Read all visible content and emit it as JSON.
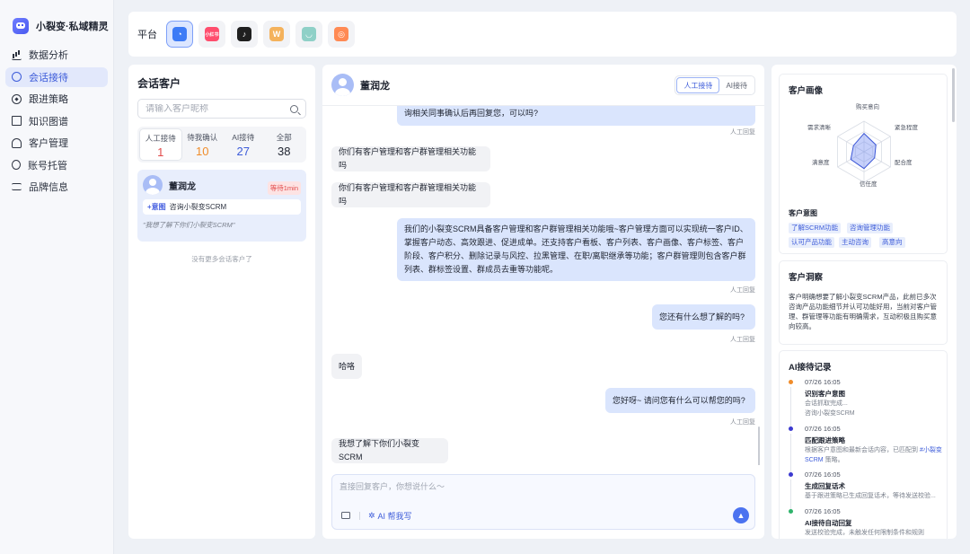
{
  "brand": {
    "name": "小裂变·私域精灵"
  },
  "nav": [
    {
      "label": "数据分析",
      "icon": "chart-icon"
    },
    {
      "label": "会话接待",
      "icon": "chat-icon",
      "active": true
    },
    {
      "label": "跟进策略",
      "icon": "compass-icon"
    },
    {
      "label": "知识图谱",
      "icon": "book-icon"
    },
    {
      "label": "客户管理",
      "icon": "user-icon"
    },
    {
      "label": "账号托管",
      "icon": "users-icon"
    },
    {
      "label": "品牌信息",
      "icon": "sliders-icon"
    }
  ],
  "platform": {
    "label": "平台",
    "items": [
      {
        "name": "wecom",
        "icon": "wecom-icon",
        "selected": true,
        "color": "#3d7bf6",
        "glyph": "◔"
      },
      {
        "name": "xiaohongshu",
        "icon": "xiaohongshu-icon",
        "color": "#ff4d6d",
        "glyph": "小红书"
      },
      {
        "name": "douyin",
        "icon": "douyin-icon",
        "color": "#1f1f1f",
        "glyph": "♪"
      },
      {
        "name": "weibo",
        "icon": "weibo-icon",
        "color": "#f4b25c",
        "glyph": "W"
      },
      {
        "name": "miniapp",
        "icon": "miniapp-icon",
        "color": "#8fd0c7",
        "glyph": "◡"
      },
      {
        "name": "kuaishou",
        "icon": "kuaishou-icon",
        "color": "#ff8a54",
        "glyph": "◎"
      }
    ]
  },
  "conversations": {
    "title": "会话客户",
    "search_placeholder": "请输入客户昵称",
    "tabs": [
      {
        "label": "人工接待",
        "count": "1",
        "color": "#e24a4a",
        "active": true
      },
      {
        "label": "待我确认",
        "count": "10",
        "color": "#f08c2a"
      },
      {
        "label": "AI接待",
        "count": "27",
        "color": "#3c5bd9"
      },
      {
        "label": "全部",
        "count": "38",
        "color": "#1f2430"
      }
    ],
    "card": {
      "name": "董润龙",
      "badge": "等待1min",
      "intent_tag": "+意图",
      "intent_text": "咨询小裂变SCRM",
      "quote": "\"我想了解下你们小裂变SCRM\""
    },
    "no_more": "没有更多会话客户了"
  },
  "chat": {
    "contact_name": "董润龙",
    "modes": [
      {
        "label": "人工接待",
        "active": true
      },
      {
        "label": "AI接待",
        "active": false
      }
    ],
    "messages": [
      {
        "dir": "out",
        "text": "询相关同事确认后再回复您，可以吗?",
        "meta": "人工回复"
      },
      {
        "dir": "in",
        "text": "你们有客户管理和客户群管理相关功能吗"
      },
      {
        "dir": "in",
        "text": "你们有客户管理和客户群管理相关功能吗"
      },
      {
        "dir": "out",
        "text": "我们的小裂变SCRM具备客户管理和客户群管理相关功能哦~客户管理方面可以实现统一客户ID、掌握客户动态、高效跟进、促进成单。还支持客户看板、客户列表、客户画像、客户标签、客户阶段、客户积分、删除记录与风控、拉黑管理、在职/离职继承等功能；客户群管理则包含客户群列表、群标签设置、群成员去重等功能呢。",
        "meta": "人工回复"
      },
      {
        "dir": "out",
        "text": "您还有什么想了解的吗?",
        "meta": "人工回复"
      },
      {
        "dir": "in",
        "text": "哈咯"
      },
      {
        "dir": "out",
        "text": "您好呀~ 请问您有什么可以帮您的吗?",
        "meta": "人工回复"
      },
      {
        "dir": "in",
        "text": "我想了解下你们小裂变SCRM"
      }
    ],
    "composer": {
      "placeholder": "直接回复客户，你想说什么～",
      "ai_help": "AI 帮我写"
    }
  },
  "profile": {
    "title": "客户画像",
    "radar_labels": [
      "购买意向",
      "紧急程度",
      "配合度",
      "信任度",
      "满意度",
      "需求清晰"
    ],
    "radar_values": [
      0.6,
      0.45,
      0.4,
      0.55,
      0.5,
      0.4
    ],
    "intent_title": "客户意图",
    "intent_chips": [
      "了解SCRM功能",
      "咨询管理功能",
      "认可产品功能",
      "主动咨询",
      "高意向"
    ]
  },
  "insight": {
    "title": "客户洞察",
    "text": "客户明确想要了解小裂变SCRM产品，此前已多次咨询产品功能细节并认可功能好用，当前对客户管理、群管理等功能有明确需求，互动积极且购买意向较高。"
  },
  "ai_records": {
    "title": "AI接待记录",
    "items": [
      {
        "time": "07/26 16:05",
        "title": "识别客户意图",
        "desc": "会话抓取完成...",
        "desc2": "咨询小裂变SCRM",
        "color": "#f08c2a"
      },
      {
        "time": "07/26 16:05",
        "title": "匹配跟进策略",
        "desc": "根据客户意图和最新会话内容，已匹配到",
        "highlight": "#小裂变SCRM",
        "desc_end": "策略。",
        "color": "#3c3ad0"
      },
      {
        "time": "07/26 16:05",
        "title": "生成回复话术",
        "desc": "基于跟进策略已生成回复话术，等待发送校验...",
        "color": "#3c3ad0"
      },
      {
        "time": "07/26 16:05",
        "title": "AI接待自动回复",
        "desc": "发送校验完成，未触发任何限制条件和规则",
        "color": "#2fb36b"
      }
    ]
  }
}
